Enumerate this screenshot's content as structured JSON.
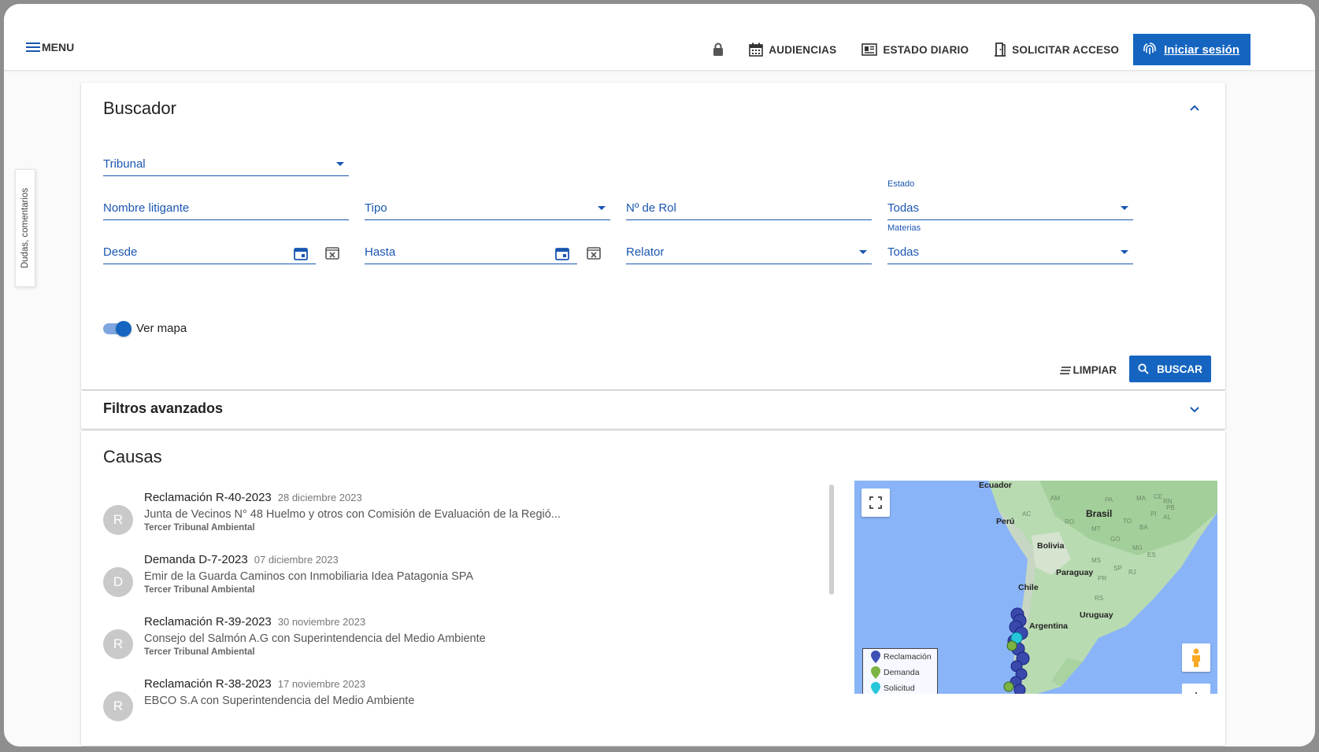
{
  "topbar": {
    "menu_label": "MENU",
    "nav": [
      {
        "label": "AUDIENCIAS",
        "icon": "calendar-icon"
      },
      {
        "label": "ESTADO DIARIO",
        "icon": "newspaper-icon"
      },
      {
        "label": "SOLICITAR ACCESO",
        "icon": "door-icon"
      }
    ],
    "lock_icon": "lock-icon",
    "login_label": "Iniciar sesión"
  },
  "side_tab": {
    "label": "Dudas, comentarios"
  },
  "buscador": {
    "title": "Buscador",
    "tribunal": {
      "label": "Tribunal"
    },
    "nombre_litigante": {
      "label": "Nombre litigante"
    },
    "tipo": {
      "label": "Tipo"
    },
    "rol": {
      "label": "Nº de Rol"
    },
    "estado": {
      "caption": "Estado",
      "value": "Todas"
    },
    "desde": {
      "label": "Desde"
    },
    "hasta": {
      "label": "Hasta"
    },
    "relator": {
      "label": "Relator"
    },
    "materias": {
      "caption": "Materias",
      "value": "Todas"
    },
    "ver_mapa": {
      "label": "Ver mapa",
      "on": true
    },
    "limpiar_label": "LIMPIAR",
    "buscar_label": "BUSCAR"
  },
  "filtros": {
    "title": "Filtros avanzados"
  },
  "causas": {
    "title": "Causas",
    "items": [
      {
        "avatar": "R",
        "title": "Reclamación R-40-2023",
        "date": "28 diciembre 2023",
        "subtitle": "Junta de Vecinos N° 48 Huelmo y otros con Comisión de Evaluación de la Regió...",
        "court": "Tercer Tribunal Ambiental"
      },
      {
        "avatar": "D",
        "title": "Demanda D-7-2023",
        "date": "07 diciembre 2023",
        "subtitle": "Emir de la Guarda Caminos con Inmobiliaria Idea Patagonia SPA",
        "court": "Tercer Tribunal Ambiental"
      },
      {
        "avatar": "R",
        "title": "Reclamación R-39-2023",
        "date": "30 noviembre 2023",
        "subtitle": "Consejo del Salmón A.G con Superintendencia del Medio Ambiente",
        "court": "Tercer Tribunal Ambiental"
      },
      {
        "avatar": "R",
        "title": "Reclamación R-38-2023",
        "date": "17 noviembre 2023",
        "subtitle": "EBCO S.A con Superintendencia del Medio Ambiente",
        "court": ""
      }
    ]
  },
  "map": {
    "countries": {
      "ecuador": "Ecuador",
      "peru": "Perú",
      "brasil": "Brasil",
      "bolivia": "Bolivia",
      "paraguay": "Paraguay",
      "chile": "Chile",
      "uruguay": "Uruguay",
      "argentina": "Argentina"
    },
    "states": [
      "AM",
      "PA",
      "MA",
      "CE",
      "RN",
      "PB",
      "AC",
      "RO",
      "MT",
      "TO",
      "BA",
      "PI",
      "AL",
      "GO",
      "MG",
      "ES",
      "MS",
      "SP",
      "PR",
      "RS",
      "RJ"
    ],
    "legend": [
      {
        "label": "Reclamación",
        "color": "#3f51b5"
      },
      {
        "label": "Demanda",
        "color": "#7cb342"
      },
      {
        "label": "Solicitud",
        "color": "#26c6da"
      }
    ],
    "zoom_label": "+"
  },
  "colors": {
    "primary": "#1565c0",
    "field": "#1a56b0",
    "ocean": "#8ab4f8",
    "land": "#b9dbb2"
  }
}
